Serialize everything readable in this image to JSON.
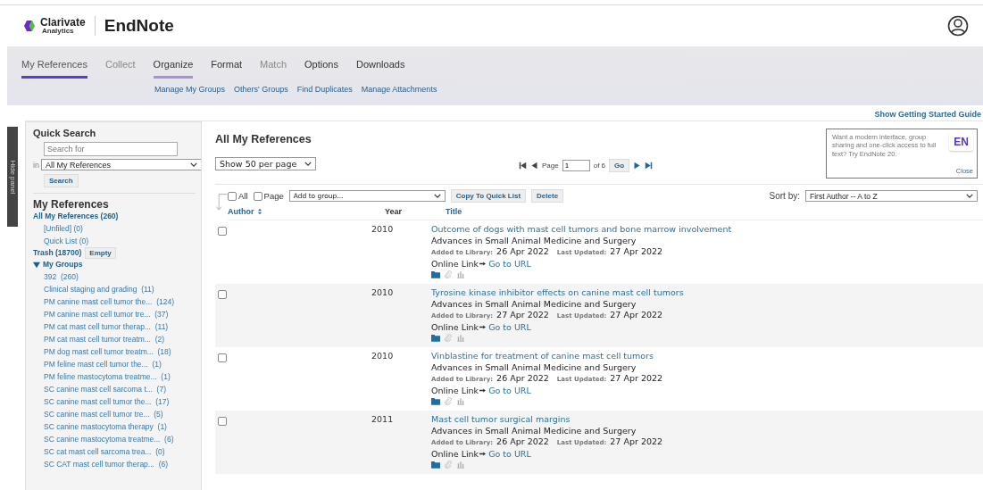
{
  "header": {
    "brand": "Clarivate",
    "brand_sub": "Analytics",
    "product": "EndNote"
  },
  "tabs": [
    {
      "label": "My References",
      "selected": false,
      "highlighted": true,
      "disabled": false
    },
    {
      "label": "Collect",
      "selected": false,
      "highlighted": false,
      "disabled": true
    },
    {
      "label": "Organize",
      "selected": true,
      "highlighted": false,
      "disabled": false
    },
    {
      "label": "Format",
      "selected": false,
      "highlighted": false,
      "disabled": false
    },
    {
      "label": "Match",
      "selected": false,
      "highlighted": false,
      "disabled": true
    },
    {
      "label": "Options",
      "selected": false,
      "highlighted": false,
      "disabled": false
    },
    {
      "label": "Downloads",
      "selected": false,
      "highlighted": false,
      "disabled": false
    }
  ],
  "subnav": [
    "Manage My Groups",
    "Others' Groups",
    "Find Duplicates",
    "Manage Attachments"
  ],
  "guide_link": "Show Getting Started Guide",
  "hide_panel": "Hide panel",
  "sidebar": {
    "quick_search": "Quick Search",
    "search_placeholder": "Search for",
    "in_label": "in",
    "scope": "All My References",
    "search_button": "Search",
    "my_references": "My References",
    "all": "All My References (260)",
    "sub_items": [
      "[Unfiled] (0)",
      "Quick List (0)"
    ],
    "trash": "Trash (18700)",
    "empty_button": "Empty",
    "groups_heading": "My Groups",
    "groups_expanded": true,
    "groups": [
      {
        "name": "392",
        "count": "(260)"
      },
      {
        "name": "Clinical staging and grading",
        "count": "(11)"
      },
      {
        "name": "PM canine mast cell tumor the...",
        "count": "(124)"
      },
      {
        "name": "PM canine mast cell tumor tre...",
        "count": "(37)"
      },
      {
        "name": "PM cat mast cell tumor therap...",
        "count": "(11)"
      },
      {
        "name": "PM cat mast cell tumor treatm...",
        "count": "(2)"
      },
      {
        "name": "PM dog mast cell tumor treatm...",
        "count": "(18)"
      },
      {
        "name": "PM feline mast cell tumor the...",
        "count": "(1)"
      },
      {
        "name": "PM feline mastocytoma treatme...",
        "count": "(1)"
      },
      {
        "name": "SC canine mast cell sarcoma t...",
        "count": "(7)"
      },
      {
        "name": "SC canine mast cell tumor the...",
        "count": "(17)"
      },
      {
        "name": "SC canine mast cell tumor tre...",
        "count": "(5)"
      },
      {
        "name": "SC canine mastocytoma therapy",
        "count": "(1)"
      },
      {
        "name": "SC canine mastocytoma treatme...",
        "count": "(6)"
      },
      {
        "name": "SC cat mast cell sarcoma trea...",
        "count": "(0)"
      },
      {
        "name": "SC CAT mast cell tumor therap...",
        "count": "(6)"
      }
    ]
  },
  "main": {
    "title": "All My References",
    "per_page": "Show 50 per page",
    "page_label": "Page",
    "page_value": "1",
    "page_of": "of 6",
    "go": "Go",
    "promo": {
      "text": "Want a modern interface, group sharing and one-click access to full text? Try EndNote 20.",
      "badge": "EN",
      "close": "Close"
    },
    "all_label": "All",
    "all_checked": false,
    "page_check_label": "Page",
    "page_checked": false,
    "add_to_group": "Add to group...",
    "copy_button": "Copy To Quick List",
    "delete_button": "Delete",
    "sort_label": "Sort by:",
    "sort_value": "First Author -- A to Z",
    "columns": [
      "Author",
      "Year",
      "Title"
    ],
    "rows": [
      {
        "checked": false,
        "year": "2010",
        "title": "Outcome of dogs with mast cell tumors and bone marrow involvement",
        "journal": "Advances in Small Animal Medicine and Surgery",
        "added_label": "Added to Library:",
        "added": "26 Apr 2022",
        "updated_label": "Last Updated:",
        "updated": "27 Apr 2022",
        "link_label": "Online Link",
        "link": "Go to URL"
      },
      {
        "checked": false,
        "year": "2010",
        "title": "Tyrosine kinase inhibitor effects on canine mast cell tumors",
        "journal": "Advances in Small Animal Medicine and Surgery",
        "added_label": "Added to Library:",
        "added": "27 Apr 2022",
        "updated_label": "Last Updated:",
        "updated": "27 Apr 2022",
        "link_label": "Online Link",
        "link": "Go to URL"
      },
      {
        "checked": false,
        "year": "2010",
        "title": "Vinblastine for treatment of canine mast cell tumors",
        "journal": "Advances in Small Animal Medicine and Surgery",
        "added_label": "Added to Library:",
        "added": "26 Apr 2022",
        "updated_label": "Last Updated:",
        "updated": "27 Apr 2022",
        "link_label": "Online Link",
        "link": "Go to URL"
      },
      {
        "checked": false,
        "year": "2011",
        "title": "Mast cell tumor surgical margins",
        "journal": "Advances in Small Animal Medicine and Surgery",
        "added_label": "Added to Library:",
        "added": "26 Apr 2022",
        "updated_label": "Last Updated:",
        "updated": "27 Apr 2022",
        "link_label": "Online Link",
        "link": "Go to URL"
      }
    ]
  }
}
